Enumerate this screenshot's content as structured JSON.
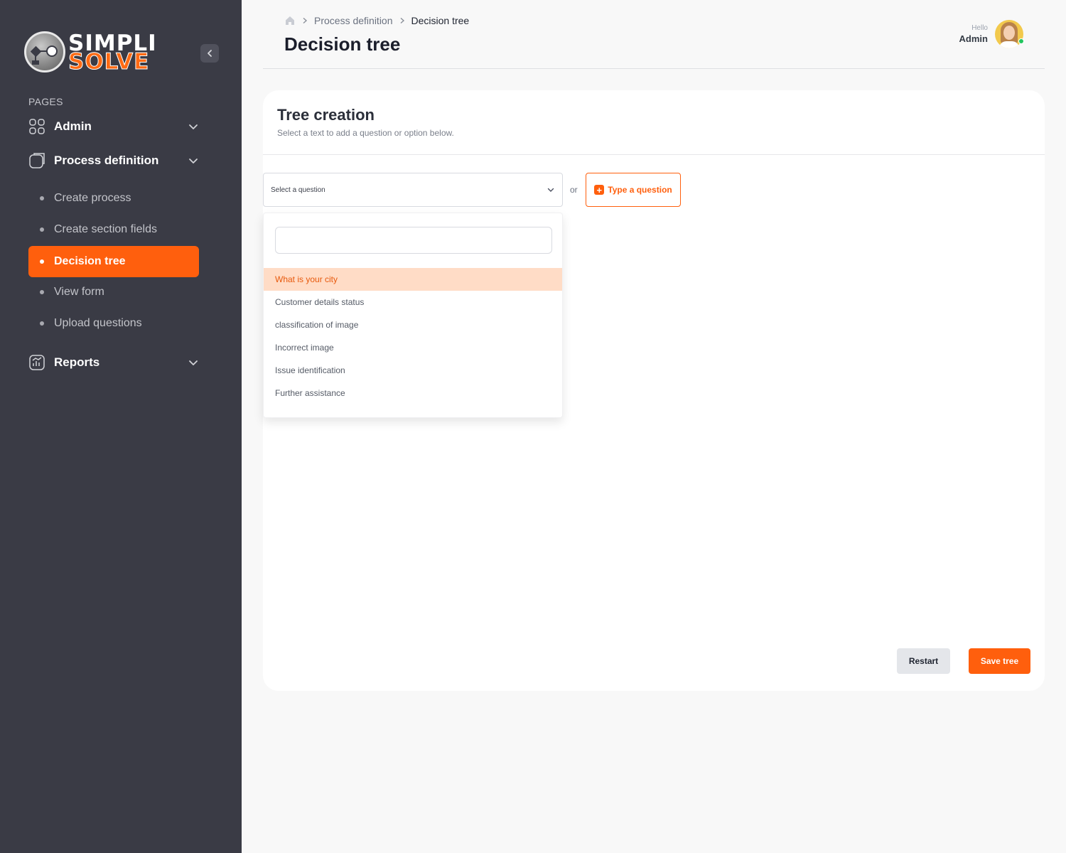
{
  "sidebar": {
    "logo": {
      "line1": "SIMPLI",
      "line2": "SOLVE"
    },
    "section_label": "PAGES",
    "groups": [
      {
        "label": "Admin",
        "icon": "grid-icon"
      },
      {
        "label": "Process definition",
        "icon": "document-icon"
      },
      {
        "label": "Reports",
        "icon": "chart-icon"
      }
    ],
    "sub_items": [
      {
        "label": "Create process"
      },
      {
        "label": "Create section fields"
      },
      {
        "label": "Decision tree",
        "active": true
      },
      {
        "label": "View form"
      },
      {
        "label": "Upload questions"
      }
    ]
  },
  "header": {
    "breadcrumb": [
      "Process definition",
      "Decision tree"
    ],
    "title": "Decision tree",
    "user": {
      "greeting": "Hello",
      "name": "Admin"
    }
  },
  "card": {
    "title": "Tree creation",
    "subtitle": "Select a text to add a question or option below.",
    "select_placeholder": "Select a question",
    "or_text": "or",
    "type_button": "Type a question",
    "search_value": "",
    "options": [
      {
        "label": "What is your city",
        "highlighted": true
      },
      {
        "label": "Customer details status"
      },
      {
        "label": "classification of image"
      },
      {
        "label": "Incorrect image"
      },
      {
        "label": "Issue identification"
      },
      {
        "label": "Further assistance"
      }
    ],
    "restart_button": "Restart",
    "save_button": "Save tree"
  },
  "colors": {
    "accent": "#ff5f0d",
    "sidebar_bg": "#3a3b45",
    "highlight": "#ffdcc6"
  }
}
